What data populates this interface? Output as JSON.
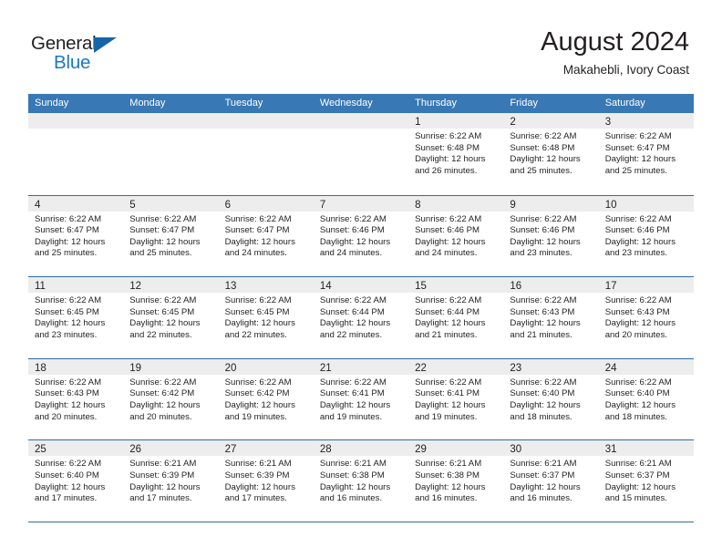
{
  "brand": {
    "name_part1": "General",
    "name_part2": "Blue",
    "accent_color": "#1879c4",
    "triangle_color": "#1565a8"
  },
  "header": {
    "month_title": "August 2024",
    "location": "Makahebli, Ivory Coast"
  },
  "theme": {
    "header_band": "#3878b4",
    "row_rule": "#2e6da4",
    "daynum_band": "#ededed",
    "text": "#231f20"
  },
  "weekdays": [
    "Sunday",
    "Monday",
    "Tuesday",
    "Wednesday",
    "Thursday",
    "Friday",
    "Saturday"
  ],
  "weeks": [
    [
      {
        "day": "",
        "sunrise": "",
        "sunset": "",
        "daylight": "",
        "empty": true
      },
      {
        "day": "",
        "sunrise": "",
        "sunset": "",
        "daylight": "",
        "empty": true
      },
      {
        "day": "",
        "sunrise": "",
        "sunset": "",
        "daylight": "",
        "empty": true
      },
      {
        "day": "",
        "sunrise": "",
        "sunset": "",
        "daylight": "",
        "empty": true
      },
      {
        "day": "1",
        "sunrise": "Sunrise: 6:22 AM",
        "sunset": "Sunset: 6:48 PM",
        "daylight": "Daylight: 12 hours and 26 minutes."
      },
      {
        "day": "2",
        "sunrise": "Sunrise: 6:22 AM",
        "sunset": "Sunset: 6:48 PM",
        "daylight": "Daylight: 12 hours and 25 minutes."
      },
      {
        "day": "3",
        "sunrise": "Sunrise: 6:22 AM",
        "sunset": "Sunset: 6:47 PM",
        "daylight": "Daylight: 12 hours and 25 minutes."
      }
    ],
    [
      {
        "day": "4",
        "sunrise": "Sunrise: 6:22 AM",
        "sunset": "Sunset: 6:47 PM",
        "daylight": "Daylight: 12 hours and 25 minutes."
      },
      {
        "day": "5",
        "sunrise": "Sunrise: 6:22 AM",
        "sunset": "Sunset: 6:47 PM",
        "daylight": "Daylight: 12 hours and 25 minutes."
      },
      {
        "day": "6",
        "sunrise": "Sunrise: 6:22 AM",
        "sunset": "Sunset: 6:47 PM",
        "daylight": "Daylight: 12 hours and 24 minutes."
      },
      {
        "day": "7",
        "sunrise": "Sunrise: 6:22 AM",
        "sunset": "Sunset: 6:46 PM",
        "daylight": "Daylight: 12 hours and 24 minutes."
      },
      {
        "day": "8",
        "sunrise": "Sunrise: 6:22 AM",
        "sunset": "Sunset: 6:46 PM",
        "daylight": "Daylight: 12 hours and 24 minutes."
      },
      {
        "day": "9",
        "sunrise": "Sunrise: 6:22 AM",
        "sunset": "Sunset: 6:46 PM",
        "daylight": "Daylight: 12 hours and 23 minutes."
      },
      {
        "day": "10",
        "sunrise": "Sunrise: 6:22 AM",
        "sunset": "Sunset: 6:46 PM",
        "daylight": "Daylight: 12 hours and 23 minutes."
      }
    ],
    [
      {
        "day": "11",
        "sunrise": "Sunrise: 6:22 AM",
        "sunset": "Sunset: 6:45 PM",
        "daylight": "Daylight: 12 hours and 23 minutes."
      },
      {
        "day": "12",
        "sunrise": "Sunrise: 6:22 AM",
        "sunset": "Sunset: 6:45 PM",
        "daylight": "Daylight: 12 hours and 22 minutes."
      },
      {
        "day": "13",
        "sunrise": "Sunrise: 6:22 AM",
        "sunset": "Sunset: 6:45 PM",
        "daylight": "Daylight: 12 hours and 22 minutes."
      },
      {
        "day": "14",
        "sunrise": "Sunrise: 6:22 AM",
        "sunset": "Sunset: 6:44 PM",
        "daylight": "Daylight: 12 hours and 22 minutes."
      },
      {
        "day": "15",
        "sunrise": "Sunrise: 6:22 AM",
        "sunset": "Sunset: 6:44 PM",
        "daylight": "Daylight: 12 hours and 21 minutes."
      },
      {
        "day": "16",
        "sunrise": "Sunrise: 6:22 AM",
        "sunset": "Sunset: 6:43 PM",
        "daylight": "Daylight: 12 hours and 21 minutes."
      },
      {
        "day": "17",
        "sunrise": "Sunrise: 6:22 AM",
        "sunset": "Sunset: 6:43 PM",
        "daylight": "Daylight: 12 hours and 20 minutes."
      }
    ],
    [
      {
        "day": "18",
        "sunrise": "Sunrise: 6:22 AM",
        "sunset": "Sunset: 6:43 PM",
        "daylight": "Daylight: 12 hours and 20 minutes."
      },
      {
        "day": "19",
        "sunrise": "Sunrise: 6:22 AM",
        "sunset": "Sunset: 6:42 PM",
        "daylight": "Daylight: 12 hours and 20 minutes."
      },
      {
        "day": "20",
        "sunrise": "Sunrise: 6:22 AM",
        "sunset": "Sunset: 6:42 PM",
        "daylight": "Daylight: 12 hours and 19 minutes."
      },
      {
        "day": "21",
        "sunrise": "Sunrise: 6:22 AM",
        "sunset": "Sunset: 6:41 PM",
        "daylight": "Daylight: 12 hours and 19 minutes."
      },
      {
        "day": "22",
        "sunrise": "Sunrise: 6:22 AM",
        "sunset": "Sunset: 6:41 PM",
        "daylight": "Daylight: 12 hours and 19 minutes."
      },
      {
        "day": "23",
        "sunrise": "Sunrise: 6:22 AM",
        "sunset": "Sunset: 6:40 PM",
        "daylight": "Daylight: 12 hours and 18 minutes."
      },
      {
        "day": "24",
        "sunrise": "Sunrise: 6:22 AM",
        "sunset": "Sunset: 6:40 PM",
        "daylight": "Daylight: 12 hours and 18 minutes."
      }
    ],
    [
      {
        "day": "25",
        "sunrise": "Sunrise: 6:22 AM",
        "sunset": "Sunset: 6:40 PM",
        "daylight": "Daylight: 12 hours and 17 minutes."
      },
      {
        "day": "26",
        "sunrise": "Sunrise: 6:21 AM",
        "sunset": "Sunset: 6:39 PM",
        "daylight": "Daylight: 12 hours and 17 minutes."
      },
      {
        "day": "27",
        "sunrise": "Sunrise: 6:21 AM",
        "sunset": "Sunset: 6:39 PM",
        "daylight": "Daylight: 12 hours and 17 minutes."
      },
      {
        "day": "28",
        "sunrise": "Sunrise: 6:21 AM",
        "sunset": "Sunset: 6:38 PM",
        "daylight": "Daylight: 12 hours and 16 minutes."
      },
      {
        "day": "29",
        "sunrise": "Sunrise: 6:21 AM",
        "sunset": "Sunset: 6:38 PM",
        "daylight": "Daylight: 12 hours and 16 minutes."
      },
      {
        "day": "30",
        "sunrise": "Sunrise: 6:21 AM",
        "sunset": "Sunset: 6:37 PM",
        "daylight": "Daylight: 12 hours and 16 minutes."
      },
      {
        "day": "31",
        "sunrise": "Sunrise: 6:21 AM",
        "sunset": "Sunset: 6:37 PM",
        "daylight": "Daylight: 12 hours and 15 minutes."
      }
    ]
  ]
}
